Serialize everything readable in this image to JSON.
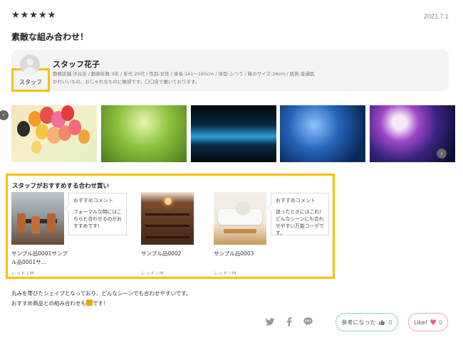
{
  "review": {
    "stars": "★★★★★",
    "date": "2021.7.1",
    "title": "素敵な組み合わせ！"
  },
  "staff": {
    "badge": "スタッフ",
    "name": "スタッフ花子",
    "meta": "勤務店舗:渋谷店 / 勤務年数:3年 / 年代:20代 / 性別:女性 / 身長:161〜165cm / 体型:ふつう / 靴のサイズ:26cm / 肌質:普通肌",
    "description": "かわいいもの、おしゃれなものに敏感です。〇〇店で働いております。"
  },
  "slider": {
    "prev_icon": "‹",
    "next_icon": "›"
  },
  "recommend": {
    "title": "スタッフがおすすめする合わせ買い",
    "products": [
      {
        "name": "サンプル品0001サンプル品0001サ…",
        "meta": "レッド / M",
        "comment_label": "おすすめコメント",
        "comment": "フォーマルな時にはこちらと合わせるのがおすすめです!"
      },
      {
        "name": "サンプル品0002",
        "meta": "レッド / M"
      },
      {
        "name": "サンプル品0003",
        "meta": "レッド / M",
        "comment_label": "おすすめコメント",
        "comment": "迷ったときにはこれ!どんなシーンにも合わせやすい万能コーデです。"
      }
    ]
  },
  "body": {
    "line1": "丸みを帯びたシェイプとなっており、どんなシーンでも合わせやすいです。",
    "line2_pre": "おすすめ商品との組み合わせも",
    "line2_post": "です！"
  },
  "actions": {
    "helpful_label": "参考になった",
    "helpful_count": "0",
    "like_label": "Like!",
    "like_count": "0"
  },
  "icons": {
    "twitter": "twitter-icon",
    "facebook": "facebook-icon",
    "line": "line-icon"
  },
  "colors": {
    "highlight": "#f5c200",
    "like_heart": "#ea5a86",
    "helpful_border": "#8fd3c9"
  }
}
